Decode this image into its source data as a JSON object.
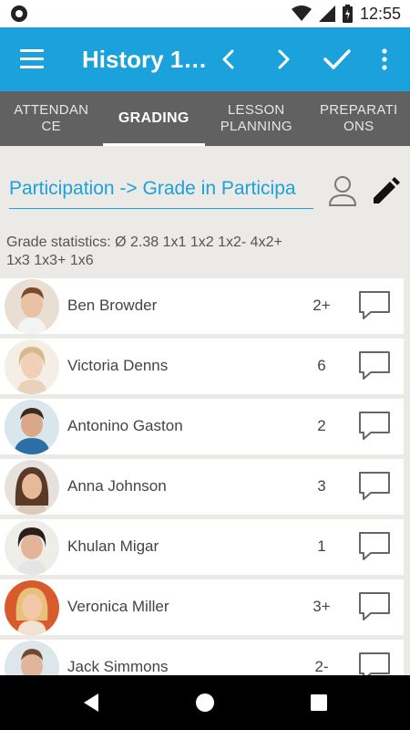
{
  "status_bar": {
    "time": "12:55",
    "icons": [
      "circle-icon",
      "wifi-icon",
      "signal-icon",
      "battery-icon"
    ]
  },
  "app_bar": {
    "title": "History 1…",
    "icons": [
      "menu-icon",
      "chevron-left-icon",
      "chevron-right-icon",
      "check-icon",
      "more-vertical-icon"
    ]
  },
  "tabs": [
    {
      "label": "ATTENDAN\nCE",
      "active": false
    },
    {
      "label": "GRADING",
      "active": true
    },
    {
      "label": "LESSON\nPLANNING",
      "active": false
    },
    {
      "label": "PREPARATI\nONS",
      "active": false
    }
  ],
  "subject": {
    "value": "Participation -> Grade in Participa"
  },
  "stats": {
    "text": "Grade statistics: Ø 2.38  1x1  1x2  1x2-  4x2+\n1x3  1x3+  1x6"
  },
  "students": [
    {
      "name": "Ben Browder",
      "grade": "2+"
    },
    {
      "name": "Victoria Denns",
      "grade": "6"
    },
    {
      "name": "Antonino Gaston",
      "grade": "2"
    },
    {
      "name": "Anna Johnson",
      "grade": "3"
    },
    {
      "name": "Khulan Migar",
      "grade": "1"
    },
    {
      "name": "Veronica Miller",
      "grade": "3+"
    },
    {
      "name": "Jack Simmons",
      "grade": "2-"
    }
  ],
  "colors": {
    "primary": "#1BA1DB",
    "tabs": "#616161",
    "background": "#ECEAE6"
  }
}
